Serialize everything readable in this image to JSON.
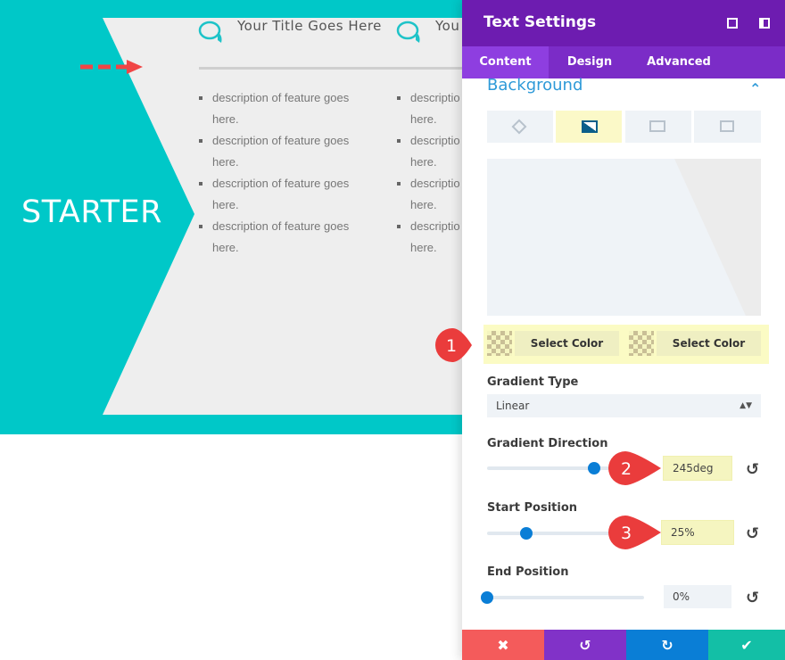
{
  "page": {
    "plan_label": "STARTER",
    "titles": [
      "Your Title Goes Here",
      "You"
    ],
    "features": [
      "description of feature goes",
      "here."
    ],
    "features_cut": [
      "descriptio",
      "here."
    ],
    "colors": {
      "teal": "#00c8c8",
      "content_bg": "#eeeeee",
      "arrow": "#f04646"
    }
  },
  "panel": {
    "title": "Text Settings",
    "header_icons": [
      "fullscreen-icon",
      "sidebar-layout-icon"
    ],
    "tabs": [
      {
        "label": "Content",
        "active": true
      },
      {
        "label": "Design"
      },
      {
        "label": "Advanced"
      }
    ],
    "section": "Background",
    "bg_types": [
      "color-fill-icon",
      "gradient-icon",
      "image-icon",
      "video-icon"
    ],
    "active_bg_type": "gradient",
    "color1": "Select Color",
    "color2": "Select Color",
    "gradient_type_label": "Gradient Type",
    "gradient_type": "Linear",
    "direction_label": "Gradient Direction",
    "direction": "245deg",
    "direction_value": 245,
    "start_label": "Start Position",
    "start": "25%",
    "start_value": 25,
    "end_label": "End Position",
    "end": "0%",
    "end_value": 0,
    "footer": [
      "cancel",
      "undo",
      "redo",
      "save"
    ],
    "colors": {
      "header": "#6d1cb0",
      "tabs": "#7b2cc7",
      "accent": "#0a7ed6",
      "cancel": "#f45b5b",
      "undo": "#8132c8",
      "redo": "#0a7ed6",
      "save": "#13bfa6"
    }
  },
  "annotations": [
    "1",
    "2",
    "3"
  ]
}
